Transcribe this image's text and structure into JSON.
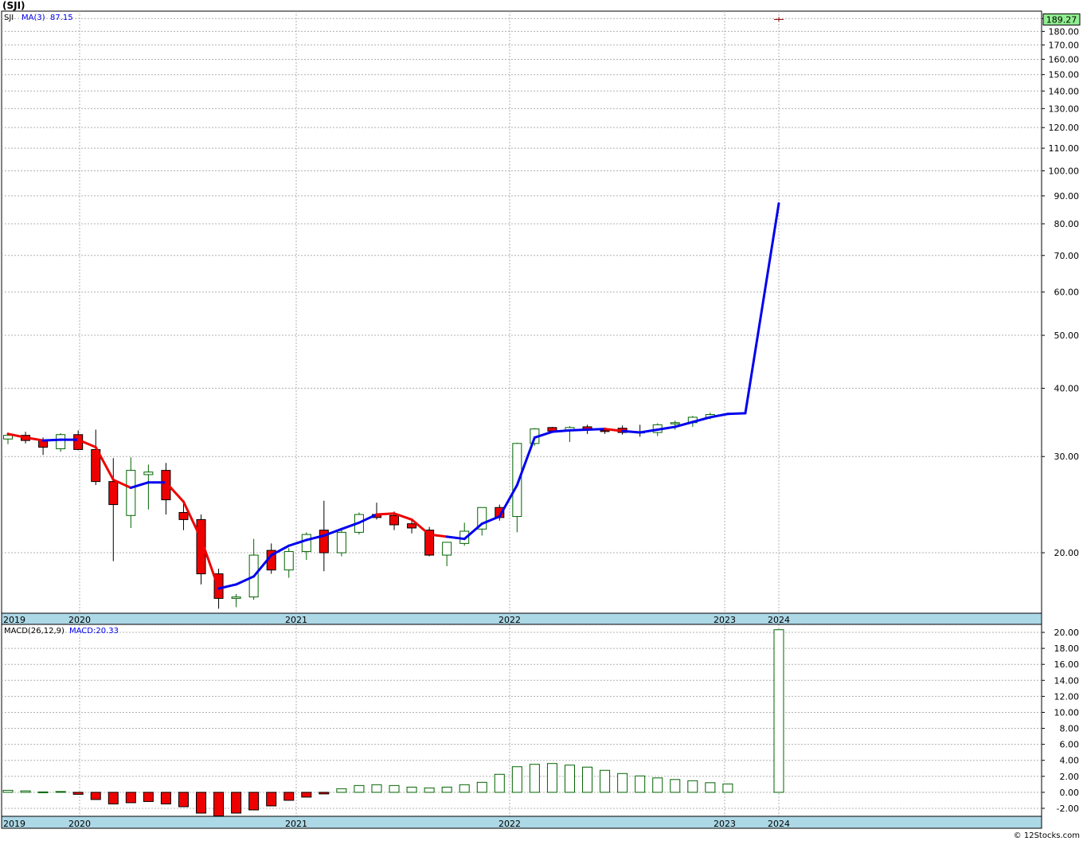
{
  "title": "(SJI)",
  "credit": "© 12Stocks.com",
  "colors": {
    "up_candle_stroke": "#006400",
    "down_candle_fill": "#ee0000",
    "ma_rising": "#0000ee",
    "ma_falling": "#ee0000",
    "axis_bar": "#add8e6",
    "grid": "#b0b0b0",
    "last_price_box": "#90ee90"
  },
  "chart_data": [
    {
      "type": "candlestick",
      "name": "price-panel",
      "legend": {
        "symbol": "SJI",
        "ma_label": "MA(3)",
        "ma_value": "87.15"
      },
      "y_scale": "log",
      "ylim": [
        15.5,
        196
      ],
      "y_ticks": [
        "190.00",
        "180.00",
        "170.00",
        "160.00",
        "150.00",
        "140.00",
        "130.00",
        "120.00",
        "110.00",
        "100.00",
        "90.00",
        "80.00",
        "70.00",
        "60.00",
        "50.00",
        "40.00",
        "30.00",
        "20.00"
      ],
      "x_labels": [
        "2019",
        "2020",
        "2021",
        "2022",
        "2023",
        "2024"
      ],
      "last_price": "189.27",
      "candles": [
        {
          "date": "2019-12",
          "open": 32.3,
          "high": 33.2,
          "low": 31.6,
          "close": 32.8
        },
        {
          "date": "2020-01",
          "open": 32.8,
          "high": 33.3,
          "low": 31.7,
          "close": 32.1
        },
        {
          "date": "2020-02",
          "open": 32.1,
          "high": 32.5,
          "low": 30.2,
          "close": 31.2
        },
        {
          "date": "2020-03",
          "open": 31.0,
          "high": 33.1,
          "low": 30.6,
          "close": 32.9
        },
        {
          "date": "2020-04",
          "open": 32.9,
          "high": 33.5,
          "low": 30.8,
          "close": 30.9
        },
        {
          "date": "2020-05",
          "open": 30.9,
          "high": 33.6,
          "low": 26.6,
          "close": 27.0
        },
        {
          "date": "2020-06",
          "open": 27.0,
          "high": 29.8,
          "low": 19.3,
          "close": 24.5
        },
        {
          "date": "2020-07",
          "open": 23.4,
          "high": 29.9,
          "low": 22.2,
          "close": 28.3
        },
        {
          "date": "2020-08",
          "open": 27.8,
          "high": 29.0,
          "low": 24.0,
          "close": 28.1
        },
        {
          "date": "2020-09",
          "open": 28.3,
          "high": 29.2,
          "low": 23.5,
          "close": 25.0
        },
        {
          "date": "2020-10",
          "open": 23.7,
          "high": 24.8,
          "low": 22.0,
          "close": 23.0
        },
        {
          "date": "2020-11",
          "open": 23.0,
          "high": 23.5,
          "low": 17.5,
          "close": 18.3
        },
        {
          "date": "2020-12",
          "open": 18.3,
          "high": 18.7,
          "low": 15.8,
          "close": 16.5
        },
        {
          "date": "2021-01",
          "open": 16.5,
          "high": 16.8,
          "low": 15.9,
          "close": 16.6
        },
        {
          "date": "2021-02",
          "open": 16.6,
          "high": 21.2,
          "low": 16.4,
          "close": 19.8
        },
        {
          "date": "2021-03",
          "open": 20.2,
          "high": 20.8,
          "low": 18.3,
          "close": 18.6
        },
        {
          "date": "2021-04",
          "open": 18.6,
          "high": 20.4,
          "low": 18.0,
          "close": 20.1
        },
        {
          "date": "2021-05",
          "open": 20.1,
          "high": 21.8,
          "low": 19.4,
          "close": 21.6
        },
        {
          "date": "2021-06",
          "open": 22.0,
          "high": 24.9,
          "low": 18.5,
          "close": 20.0
        },
        {
          "date": "2021-07",
          "open": 20.0,
          "high": 22.0,
          "low": 19.7,
          "close": 21.8
        },
        {
          "date": "2021-08",
          "open": 21.8,
          "high": 23.7,
          "low": 21.6,
          "close": 23.5
        },
        {
          "date": "2021-09",
          "open": 23.5,
          "high": 24.7,
          "low": 23.0,
          "close": 23.2
        },
        {
          "date": "2021-10",
          "open": 23.4,
          "high": 23.8,
          "low": 22.0,
          "close": 22.5
        },
        {
          "date": "2021-11",
          "open": 22.6,
          "high": 23.1,
          "low": 21.7,
          "close": 22.2
        },
        {
          "date": "2021-12",
          "open": 22.0,
          "high": 22.3,
          "low": 19.7,
          "close": 19.8
        },
        {
          "date": "2022-01",
          "open": 19.8,
          "high": 20.9,
          "low": 18.9,
          "close": 20.9
        },
        {
          "date": "2022-02",
          "open": 20.8,
          "high": 22.7,
          "low": 20.6,
          "close": 21.9
        },
        {
          "date": "2022-03",
          "open": 22.1,
          "high": 24.2,
          "low": 21.5,
          "close": 24.2
        },
        {
          "date": "2022-04",
          "open": 24.2,
          "high": 24.5,
          "low": 22.9,
          "close": 23.2
        },
        {
          "date": "2022-05",
          "open": 23.3,
          "high": 31.8,
          "low": 21.8,
          "close": 31.7
        },
        {
          "date": "2022-06",
          "open": 31.7,
          "high": 33.8,
          "low": 31.4,
          "close": 33.7
        },
        {
          "date": "2022-07",
          "open": 33.9,
          "high": 34.0,
          "low": 33.3,
          "close": 33.4
        },
        {
          "date": "2022-08",
          "open": 33.5,
          "high": 34.1,
          "low": 31.9,
          "close": 33.9
        },
        {
          "date": "2022-09",
          "open": 34.0,
          "high": 34.3,
          "low": 33.0,
          "close": 33.6
        },
        {
          "date": "2022-10",
          "open": 33.5,
          "high": 33.9,
          "low": 33.0,
          "close": 33.4
        },
        {
          "date": "2022-11",
          "open": 33.8,
          "high": 34.2,
          "low": 32.9,
          "close": 33.2
        },
        {
          "date": "2022-12",
          "open": 33.3,
          "high": 34.3,
          "low": 32.6,
          "close": 33.2
        },
        {
          "date": "2023-01",
          "open": 33.2,
          "high": 34.5,
          "low": 32.7,
          "close": 34.3
        },
        {
          "date": "2023-02",
          "open": 34.5,
          "high": 34.9,
          "low": 33.6,
          "close": 34.6
        },
        {
          "date": "2023-03",
          "open": 34.6,
          "high": 35.6,
          "low": 34.0,
          "close": 35.4
        },
        {
          "date": "2023-04",
          "open": 35.4,
          "high": 36.1,
          "low": 35.1,
          "close": 35.8
        },
        {
          "date": "2024-01",
          "open": 189.27,
          "high": 189.27,
          "low": 189.27,
          "close": 189.27
        }
      ],
      "ma3": [
        {
          "date": "2019-12",
          "value": 33.0,
          "color": "falling"
        },
        {
          "date": "2020-01",
          "value": 32.5,
          "color": "falling"
        },
        {
          "date": "2020-02",
          "value": 32.1,
          "color": "falling"
        },
        {
          "date": "2020-03",
          "value": 32.2,
          "color": "rising"
        },
        {
          "date": "2020-04",
          "value": 32.2,
          "color": "rising"
        },
        {
          "date": "2020-05",
          "value": 31.2,
          "color": "falling"
        },
        {
          "date": "2020-06",
          "value": 27.2,
          "color": "falling"
        },
        {
          "date": "2020-07",
          "value": 26.3,
          "color": "falling"
        },
        {
          "date": "2020-08",
          "value": 26.9,
          "color": "rising"
        },
        {
          "date": "2020-09",
          "value": 26.9,
          "color": "rising"
        },
        {
          "date": "2020-10",
          "value": 24.8,
          "color": "falling"
        },
        {
          "date": "2020-11",
          "value": 21.2,
          "color": "falling"
        },
        {
          "date": "2020-12",
          "value": 17.2,
          "color": "falling"
        },
        {
          "date": "2021-01",
          "value": 17.5,
          "color": "rising"
        },
        {
          "date": "2021-02",
          "value": 18.1,
          "color": "rising"
        },
        {
          "date": "2021-03",
          "value": 19.8,
          "color": "rising"
        },
        {
          "date": "2021-04",
          "value": 20.6,
          "color": "rising"
        },
        {
          "date": "2021-05",
          "value": 21.1,
          "color": "rising"
        },
        {
          "date": "2021-06",
          "value": 21.5,
          "color": "rising"
        },
        {
          "date": "2021-07",
          "value": 22.1,
          "color": "rising"
        },
        {
          "date": "2021-08",
          "value": 22.7,
          "color": "rising"
        },
        {
          "date": "2021-09",
          "value": 23.5,
          "color": "rising"
        },
        {
          "date": "2021-10",
          "value": 23.6,
          "color": "falling"
        },
        {
          "date": "2021-11",
          "value": 23.0,
          "color": "falling"
        },
        {
          "date": "2021-12",
          "value": 21.6,
          "color": "falling"
        },
        {
          "date": "2022-01",
          "value": 21.4,
          "color": "falling"
        },
        {
          "date": "2022-02",
          "value": 21.2,
          "color": "rising"
        },
        {
          "date": "2022-03",
          "value": 22.6,
          "color": "rising"
        },
        {
          "date": "2022-04",
          "value": 23.3,
          "color": "rising"
        },
        {
          "date": "2022-05",
          "value": 26.6,
          "color": "rising"
        },
        {
          "date": "2022-06",
          "value": 32.5,
          "color": "rising"
        },
        {
          "date": "2022-07",
          "value": 33.3,
          "color": "rising"
        },
        {
          "date": "2022-08",
          "value": 33.5,
          "color": "rising"
        },
        {
          "date": "2022-09",
          "value": 33.6,
          "color": "rising"
        },
        {
          "date": "2022-10",
          "value": 33.7,
          "color": "rising"
        },
        {
          "date": "2022-11",
          "value": 33.4,
          "color": "falling"
        },
        {
          "date": "2022-12",
          "value": 33.2,
          "color": "rising"
        },
        {
          "date": "2023-01",
          "value": 33.6,
          "color": "rising"
        },
        {
          "date": "2023-02",
          "value": 34.0,
          "color": "rising"
        },
        {
          "date": "2023-03",
          "value": 34.7,
          "color": "rising"
        },
        {
          "date": "2023-04",
          "value": 35.4,
          "color": "rising"
        },
        {
          "date": "2023-05",
          "value": 35.9,
          "color": "rising"
        },
        {
          "date": "2023-06",
          "value": 36.0,
          "color": "rising"
        },
        {
          "date": "2024-01",
          "value": 87.15,
          "color": "rising"
        }
      ]
    },
    {
      "type": "bar",
      "name": "macd-panel",
      "legend": {
        "label": "MACD(26,12,9)",
        "value_label": "MACD:20.33"
      },
      "ylim": [
        -3.0,
        21.0
      ],
      "y_ticks": [
        "20.00",
        "18.00",
        "16.00",
        "14.00",
        "12.00",
        "10.00",
        "8.00",
        "6.00",
        "4.00",
        "2.00",
        "0.00",
        "-2.00"
      ],
      "x_labels": [
        "2019",
        "2020",
        "2021",
        "2022",
        "2023",
        "2024"
      ],
      "bars": [
        {
          "date": "2019-12",
          "value": 0.25
        },
        {
          "date": "2020-01",
          "value": 0.18
        },
        {
          "date": "2020-02",
          "value": 0.05
        },
        {
          "date": "2020-03",
          "value": 0.1
        },
        {
          "date": "2020-04",
          "value": -0.25
        },
        {
          "date": "2020-05",
          "value": -0.9
        },
        {
          "date": "2020-06",
          "value": -1.45
        },
        {
          "date": "2020-07",
          "value": -1.3
        },
        {
          "date": "2020-08",
          "value": -1.15
        },
        {
          "date": "2020-09",
          "value": -1.45
        },
        {
          "date": "2020-10",
          "value": -1.8
        },
        {
          "date": "2020-11",
          "value": -2.6
        },
        {
          "date": "2020-12",
          "value": -2.95
        },
        {
          "date": "2021-01",
          "value": -2.6
        },
        {
          "date": "2021-02",
          "value": -2.2
        },
        {
          "date": "2021-03",
          "value": -1.7
        },
        {
          "date": "2021-04",
          "value": -1.0
        },
        {
          "date": "2021-05",
          "value": -0.6
        },
        {
          "date": "2021-06",
          "value": -0.2
        },
        {
          "date": "2021-07",
          "value": 0.45
        },
        {
          "date": "2021-08",
          "value": 0.85
        },
        {
          "date": "2021-09",
          "value": 0.95
        },
        {
          "date": "2021-10",
          "value": 0.85
        },
        {
          "date": "2021-11",
          "value": 0.65
        },
        {
          "date": "2021-12",
          "value": 0.55
        },
        {
          "date": "2022-01",
          "value": 0.65
        },
        {
          "date": "2022-02",
          "value": 0.95
        },
        {
          "date": "2022-03",
          "value": 1.25
        },
        {
          "date": "2022-04",
          "value": 2.25
        },
        {
          "date": "2022-05",
          "value": 3.2
        },
        {
          "date": "2022-06",
          "value": 3.5
        },
        {
          "date": "2022-07",
          "value": 3.6
        },
        {
          "date": "2022-08",
          "value": 3.4
        },
        {
          "date": "2022-09",
          "value": 3.15
        },
        {
          "date": "2022-10",
          "value": 2.75
        },
        {
          "date": "2022-11",
          "value": 2.35
        },
        {
          "date": "2022-12",
          "value": 2.05
        },
        {
          "date": "2023-01",
          "value": 1.8
        },
        {
          "date": "2023-02",
          "value": 1.6
        },
        {
          "date": "2023-03",
          "value": 1.45
        },
        {
          "date": "2023-04",
          "value": 1.2
        },
        {
          "date": "2023-05",
          "value": 1.05
        },
        {
          "date": "2024-01",
          "value": 20.33
        }
      ]
    }
  ]
}
